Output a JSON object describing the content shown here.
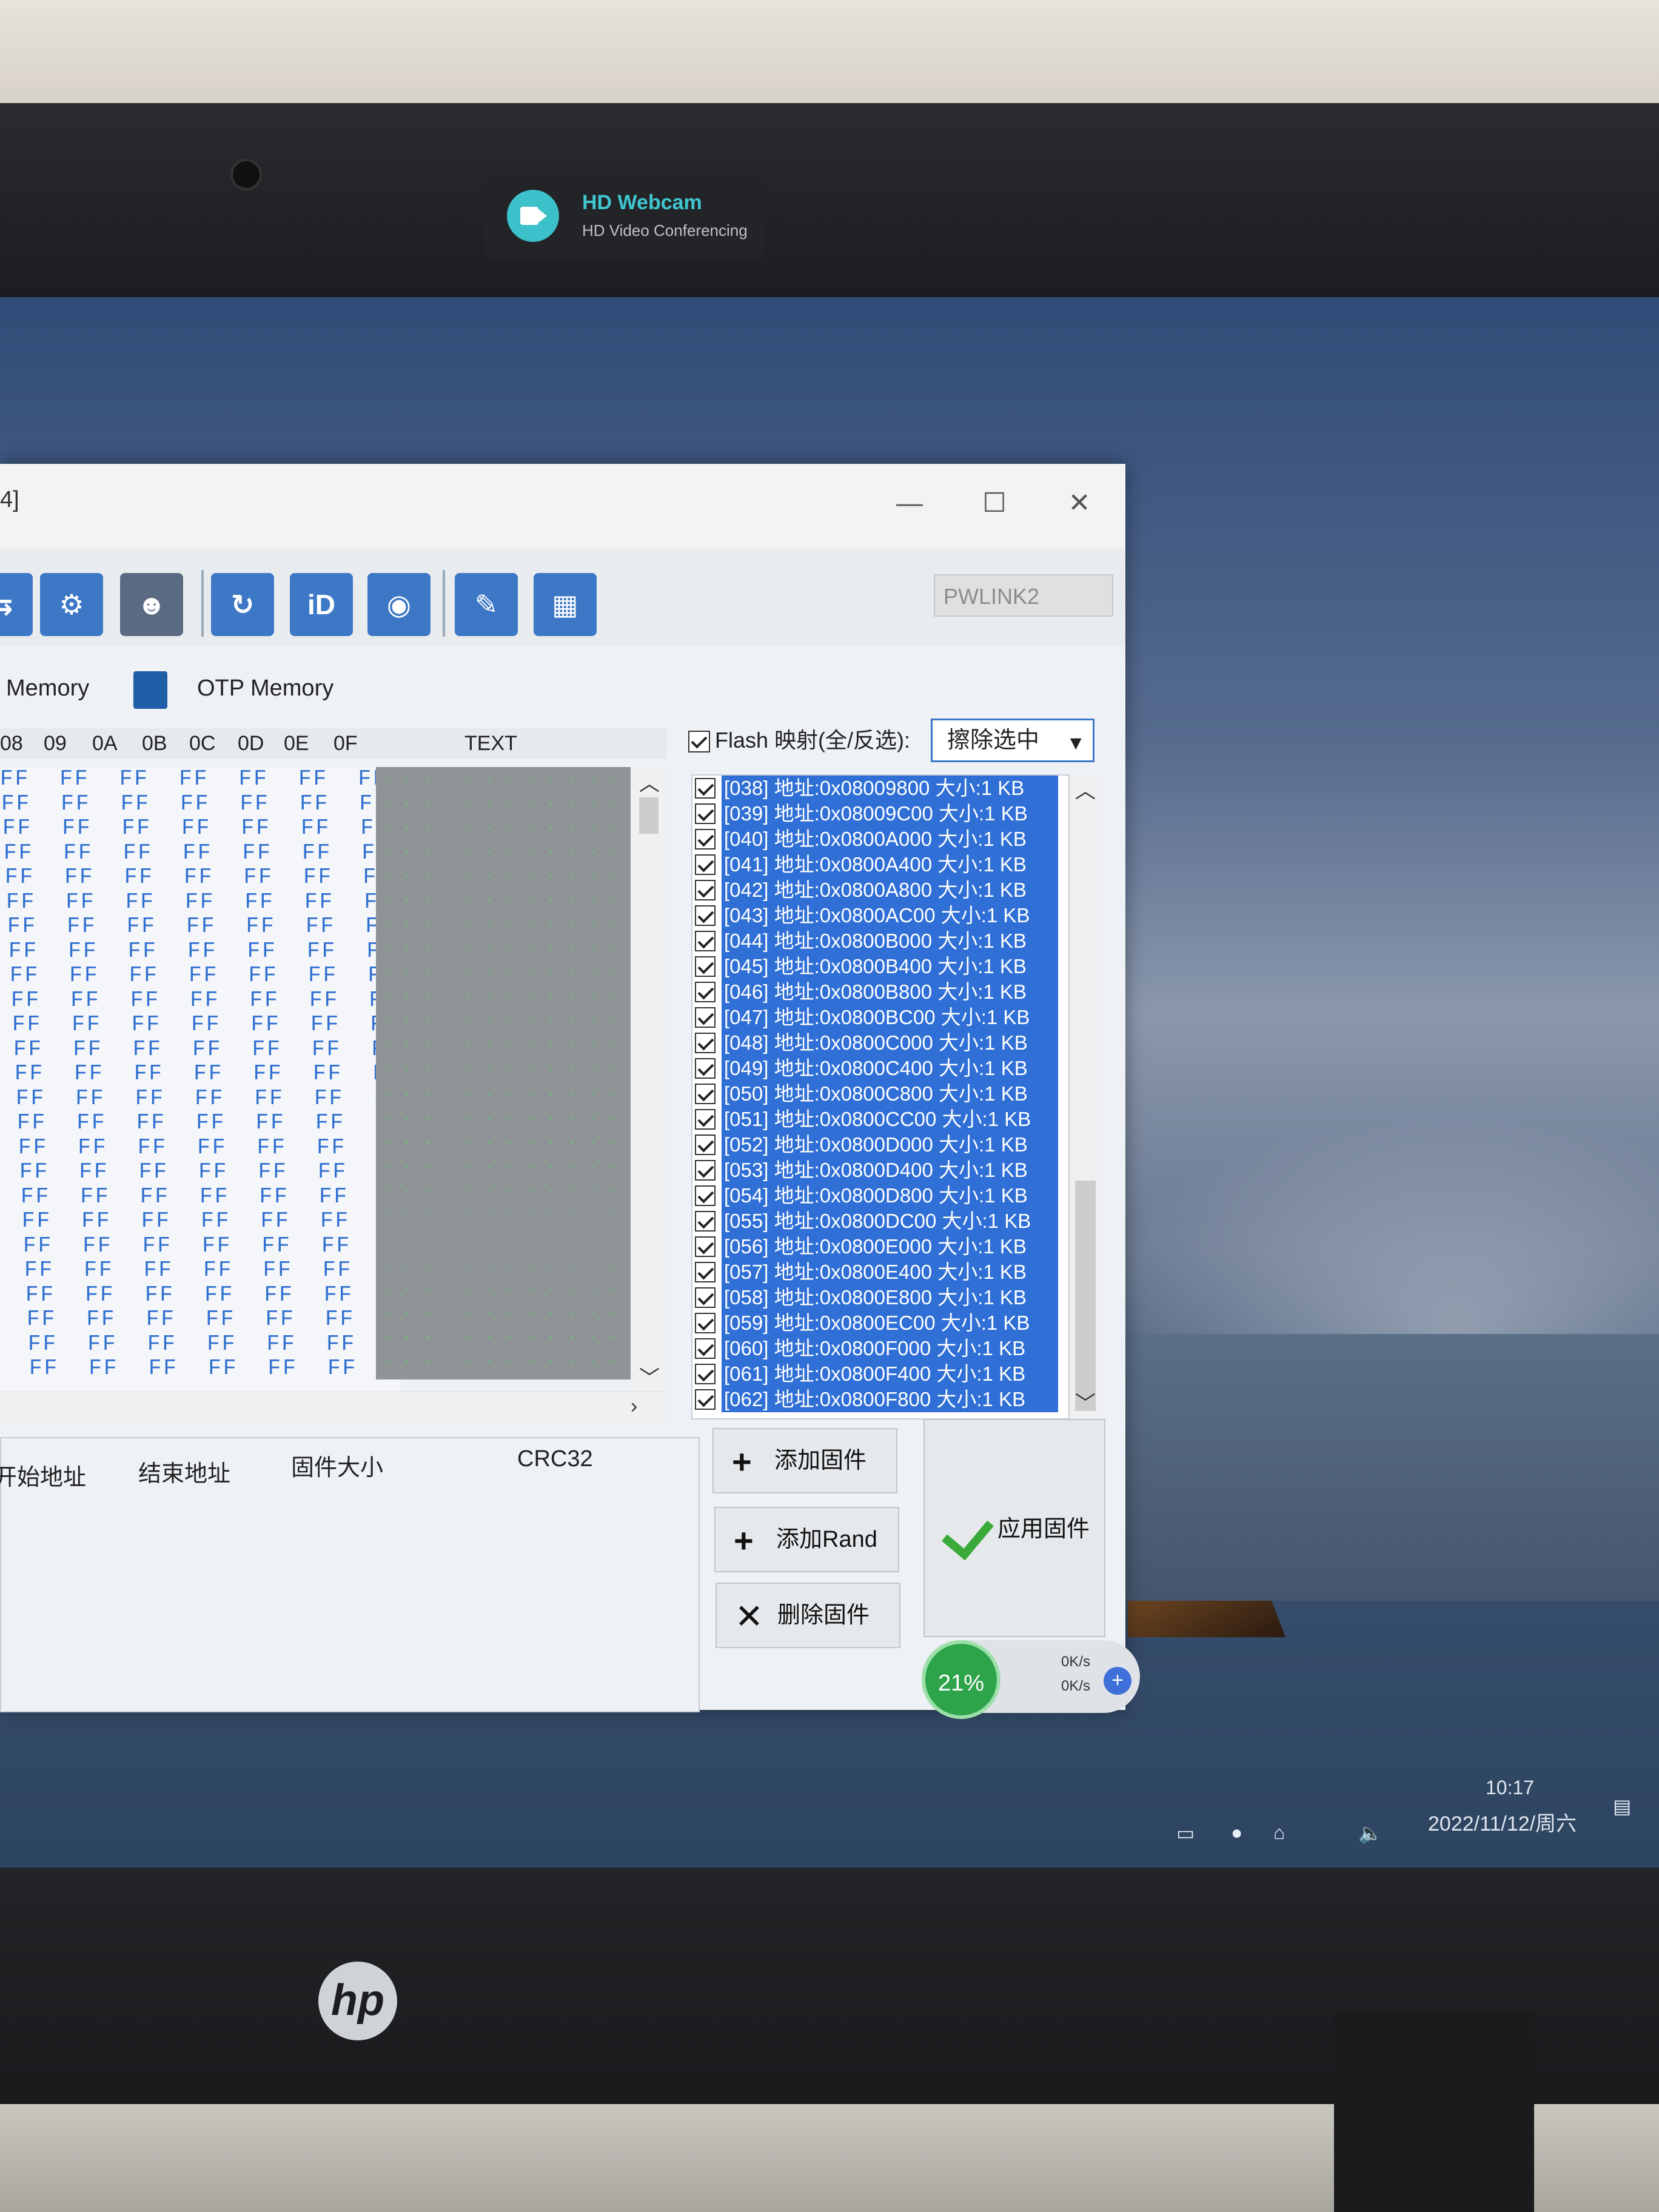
{
  "webcam": {
    "title": "HD Webcam",
    "subtitle": "HD Video Conferencing"
  },
  "window": {
    "title_fragment": "4]",
    "minimize": "—",
    "maximize": "☐",
    "close": "✕"
  },
  "toolbar": {
    "device": "PWLINK2",
    "icons": [
      "connect-icon",
      "settings-icon",
      "robot-icon",
      "refresh-icon",
      "id-icon",
      "record-icon",
      "erase-icon",
      "chip-icon"
    ]
  },
  "tabs": {
    "memory": "Memory",
    "otp": "OTP Memory"
  },
  "hex": {
    "columns": [
      "08",
      "09",
      "0A",
      "0B",
      "0C",
      "0D",
      "0E",
      "0F"
    ],
    "text_header": "TEXT",
    "fill_byte": "FF",
    "rows": 25
  },
  "firmware_table": {
    "columns": [
      "开始地址",
      "结束地址",
      "固件大小",
      "CRC32"
    ]
  },
  "flash": {
    "map_label": "Flash 映射(全/反选):",
    "erase_option": "擦除选中",
    "sectors": [
      "[038] 地址:0x08009800 大小:1 KB",
      "[039] 地址:0x08009C00 大小:1 KB",
      "[040] 地址:0x0800A000 大小:1 KB",
      "[041] 地址:0x0800A400 大小:1 KB",
      "[042] 地址:0x0800A800 大小:1 KB",
      "[043] 地址:0x0800AC00 大小:1 KB",
      "[044] 地址:0x0800B000 大小:1 KB",
      "[045] 地址:0x0800B400 大小:1 KB",
      "[046] 地址:0x0800B800 大小:1 KB",
      "[047] 地址:0x0800BC00 大小:1 KB",
      "[048] 地址:0x0800C000 大小:1 KB",
      "[049] 地址:0x0800C400 大小:1 KB",
      "[050] 地址:0x0800C800 大小:1 KB",
      "[051] 地址:0x0800CC00 大小:1 KB",
      "[052] 地址:0x0800D000 大小:1 KB",
      "[053] 地址:0x0800D400 大小:1 KB",
      "[054] 地址:0x0800D800 大小:1 KB",
      "[055] 地址:0x0800DC00 大小:1 KB",
      "[056] 地址:0x0800E000 大小:1 KB",
      "[057] 地址:0x0800E400 大小:1 KB",
      "[058] 地址:0x0800E800 大小:1 KB",
      "[059] 地址:0x0800EC00 大小:1 KB",
      "[060] 地址:0x0800F000 大小:1 KB",
      "[061] 地址:0x0800F400 大小:1 KB",
      "[062] 地址:0x0800F800 大小:1 KB"
    ]
  },
  "buttons": {
    "add_firmware": "添加固件",
    "add_rand": "添加Rand",
    "delete_firmware": "删除固件",
    "apply_firmware": "应用固件"
  },
  "net": {
    "percent": "21%",
    "up": "0K/s",
    "down": "0K/s",
    "plus": "+"
  },
  "tray": {
    "time": "10:17",
    "date": "2022/11/12/周六"
  },
  "laptop": {
    "brand": "hp"
  }
}
